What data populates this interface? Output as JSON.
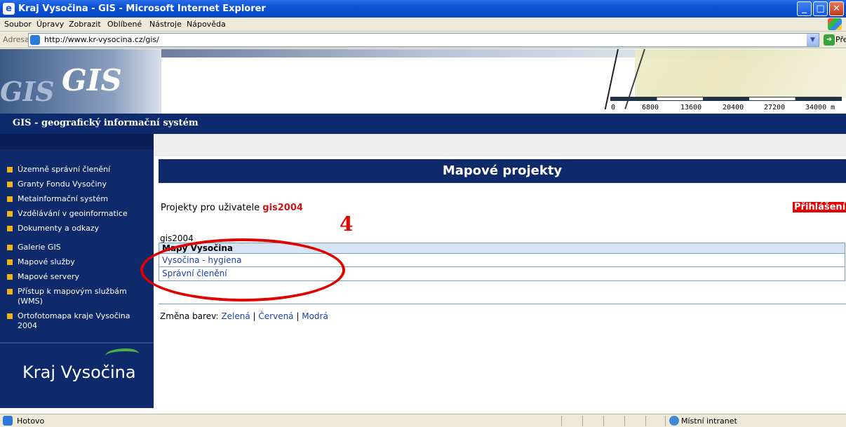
{
  "window": {
    "title": "Kraj Vysočina - GIS - Microsoft Internet Explorer",
    "buttons": {
      "minimize": "_",
      "maximize": "□",
      "close": "✕"
    }
  },
  "menu": [
    "Soubor",
    "Úpravy",
    "Zobrazit",
    "Oblíbené",
    "Nástroje",
    "Nápověda"
  ],
  "address": {
    "label": "Adresa",
    "url": "http://www.kr-vysocina.cz/gis/",
    "go_label": "Přejít"
  },
  "header": {
    "logo_text": "GIS",
    "scale_labels": [
      "0",
      "6800",
      "13600",
      "20400",
      "27200",
      "34000 m"
    ],
    "subtitle": "GIS - geografický informační systém"
  },
  "sidebar": {
    "items": [
      "Územně správní členění",
      "Granty Fondu Vysočiny",
      "Metainformační systém",
      "Vzdělávání v geoinformatice",
      "Dokumenty a odkazy",
      "Galerie GIS",
      "Mapové služby",
      "Mapové servery",
      "Přístup k mapovým službám (WMS)",
      "Ortofotomapa kraje Vysočina 2004"
    ],
    "brand": "Kraj Vysočina"
  },
  "main": {
    "heading": "Mapové projekty",
    "projects_for_user_label": "Projekty pro uživatele",
    "user": "gis2004",
    "login_label": "Přihlášení",
    "annotation_number": "4",
    "group_user": "gis2004",
    "table": {
      "header": "Mapy Vysočina",
      "rows": [
        "Vysočina - hygiena",
        "Správní členění"
      ]
    },
    "color_change": {
      "label": "Změna barev:",
      "options": [
        "Zelená",
        "Červená",
        "Modrá"
      ],
      "separator": "|"
    }
  },
  "status": {
    "text": "Hotovo",
    "zone": "Místní intranet"
  },
  "colors": {
    "navy": "#0e2a6b",
    "accent_red": "#e00000",
    "nav_bullet": "#f0b41c",
    "link": "#1b3fa8"
  }
}
